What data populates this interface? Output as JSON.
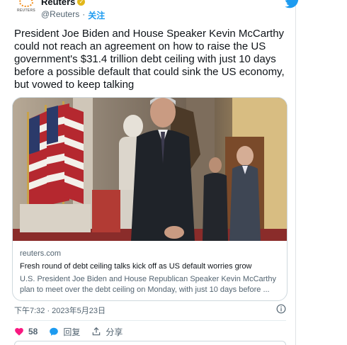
{
  "author": {
    "avatar_text": "REUTERS",
    "display_name": "Reuters",
    "handle": "@Reuters",
    "separator": "·",
    "follow_label": "关注"
  },
  "tweet": {
    "text": "President Joe Biden and House Speaker Kevin McCarthy could not reach an agreement on how to raise the US government's $31.4 trillion debt ceiling with just 10 days before a possible default that could sink the US economy, but vowed to keep talking"
  },
  "link_card": {
    "domain": "reuters.com",
    "title": "Fresh round of debt ceiling talks kick off as US default worries grow",
    "description": "U.S. President Joe Biden and House Republican Speaker Kevin McCarthy plan to meet over the debt ceiling on Monday, with just 10 days before ..."
  },
  "timestamp": "下午7:32 · 2023年5月23日",
  "actions": {
    "like_count": "58",
    "reply_label": "回复",
    "share_label": "分享"
  },
  "colors": {
    "accent": "#1d9bf0",
    "like": "#f91880",
    "verified": "#e2b719"
  },
  "icons": [
    "twitter-bird-icon",
    "verified-badge-icon",
    "info-icon",
    "heart-icon",
    "reply-bubble-icon",
    "share-icon"
  ]
}
